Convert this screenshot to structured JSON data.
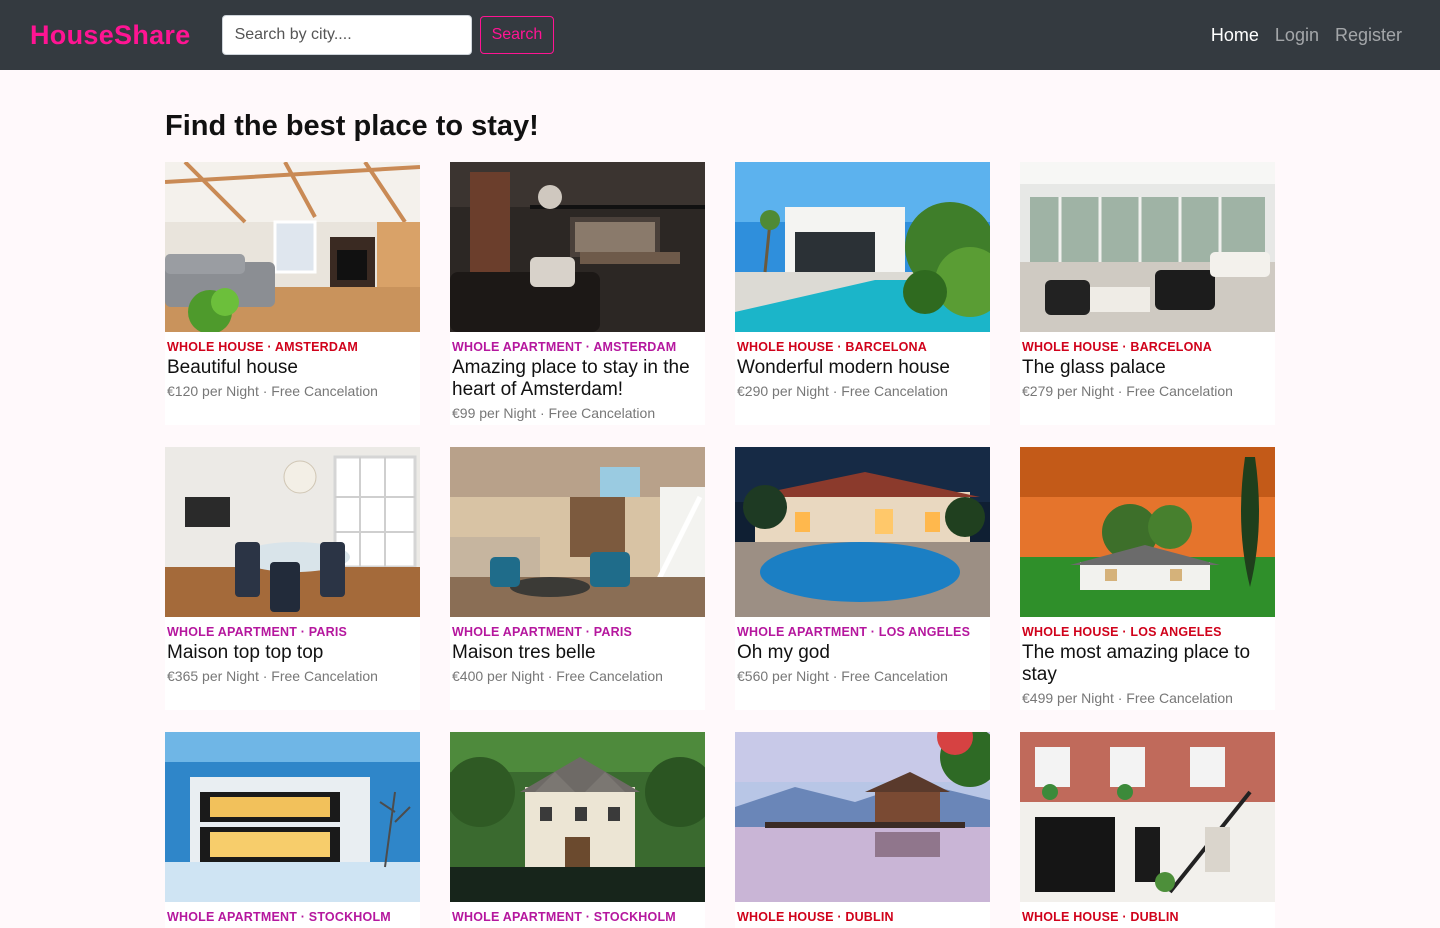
{
  "nav": {
    "brand": "HouseShare",
    "search_placeholder": "Search by city....",
    "search_button": "Search",
    "links": [
      "Home",
      "Login",
      "Register"
    ]
  },
  "page": {
    "title": "Find the best place to stay!"
  },
  "colors": {
    "house": "#d0021b",
    "apartment": "#b5179e",
    "brand": "#ff1493",
    "navbar": "#343a40"
  },
  "listings": [
    {
      "category": "WHOLE HOUSE · AMSTERDAM",
      "type": "house",
      "title": "Beautiful house",
      "price": "€120 per Night · Free Cancelation",
      "photo": "living-room-photo"
    },
    {
      "category": "WHOLE APARTMENT · AMSTERDAM",
      "type": "apartment",
      "title": "Amazing place to stay in the heart of Amsterdam!",
      "price": "€99 per Night · Free Cancelation",
      "photo": "loft-photo"
    },
    {
      "category": "WHOLE HOUSE · BARCELONA",
      "type": "house",
      "title": "Wonderful modern house",
      "price": "€290 per Night · Free Cancelation",
      "photo": "pool-villa-photo"
    },
    {
      "category": "WHOLE HOUSE · BARCELONA",
      "type": "house",
      "title": "The glass palace",
      "price": "€279 per Night · Free Cancelation",
      "photo": "glass-living-photo"
    },
    {
      "category": "WHOLE APARTMENT · PARIS",
      "type": "apartment",
      "title": "Maison top top top",
      "price": "€365 per Night · Free Cancelation",
      "photo": "dining-room-photo"
    },
    {
      "category": "WHOLE APARTMENT · PARIS",
      "type": "apartment",
      "title": "Maison tres belle",
      "price": "€400 per Night · Free Cancelation",
      "photo": "lounge-photo"
    },
    {
      "category": "WHOLE APARTMENT · LOS ANGELES",
      "type": "apartment",
      "title": "Oh my god",
      "price": "€560 per Night · Free Cancelation",
      "photo": "night-pool-photo"
    },
    {
      "category": "WHOLE HOUSE · LOS ANGELES",
      "type": "house",
      "title": "The most amazing place to stay",
      "price": "€499 per Night · Free Cancelation",
      "photo": "sunset-house-photo"
    },
    {
      "category": "WHOLE APARTMENT · STOCKHOLM",
      "type": "apartment",
      "title": "",
      "price": "",
      "photo": "winter-house-photo"
    },
    {
      "category": "WHOLE APARTMENT · STOCKHOLM",
      "type": "apartment",
      "title": "",
      "price": "",
      "photo": "forest-manor-photo"
    },
    {
      "category": "WHOLE HOUSE · DUBLIN",
      "type": "house",
      "title": "",
      "price": "",
      "photo": "lake-view-photo"
    },
    {
      "category": "WHOLE HOUSE · DUBLIN",
      "type": "house",
      "title": "",
      "price": "",
      "photo": "brick-house-photo"
    }
  ]
}
